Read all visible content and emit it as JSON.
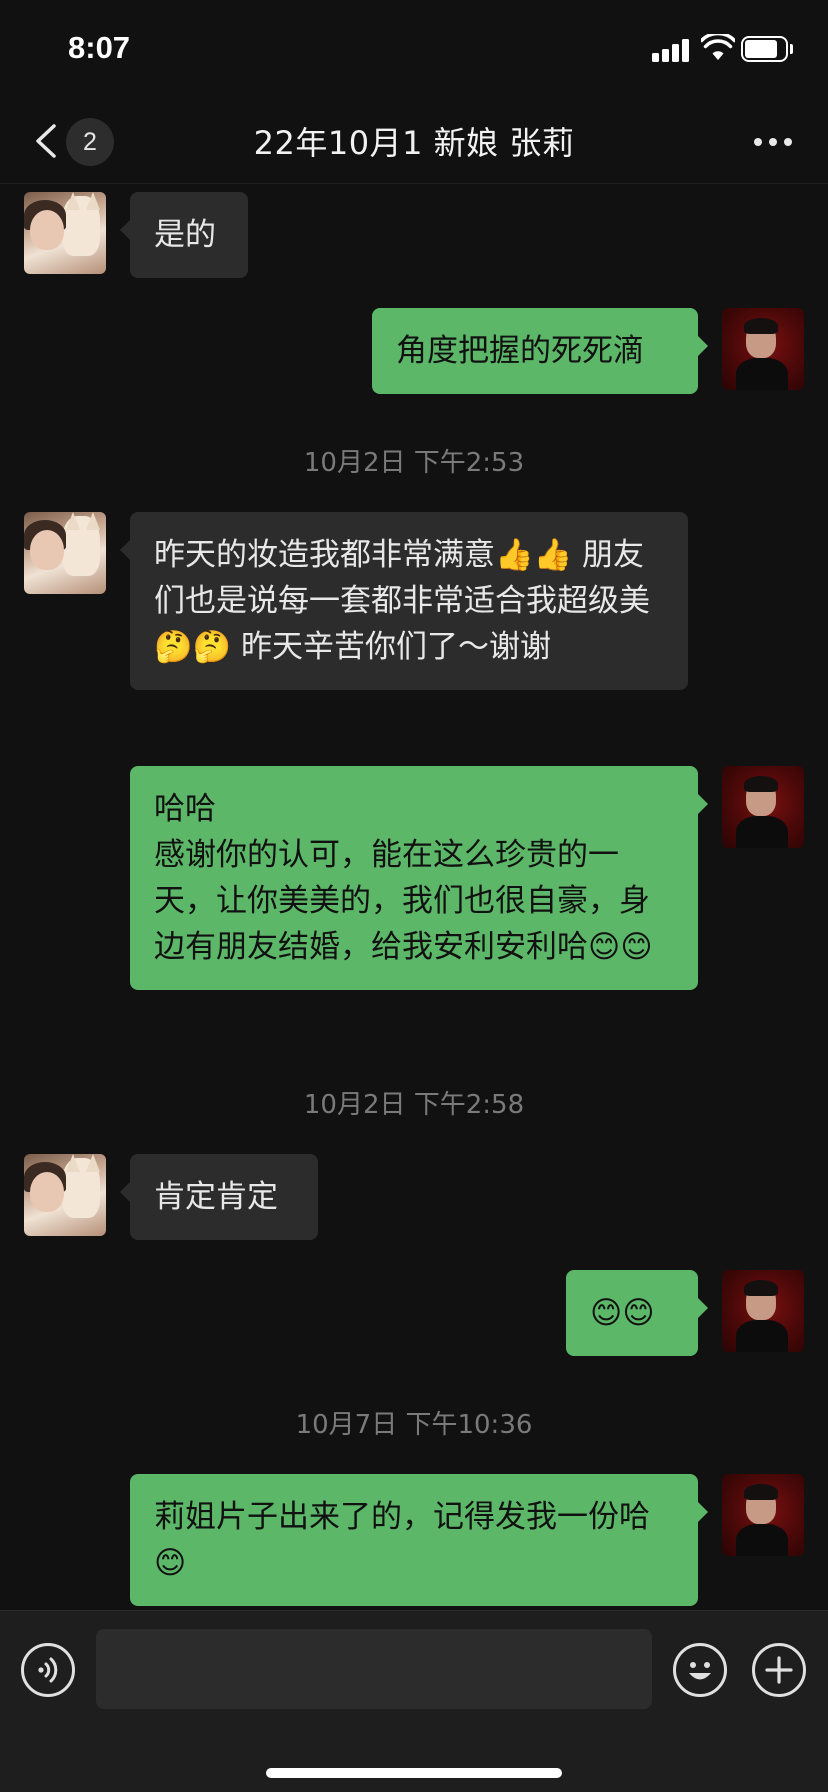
{
  "status_bar": {
    "time": "8:07"
  },
  "nav": {
    "unread_count": "2",
    "title": "22年10月1 新娘 张莉"
  },
  "messages": [
    {
      "kind": "in",
      "text": "是的"
    },
    {
      "kind": "out",
      "text": "角度把握的死死滴"
    },
    {
      "kind": "time",
      "text": "10月2日 下午2:53"
    },
    {
      "kind": "in",
      "text": "昨天的妆造我都非常满意👍👍 朋友们也是说每一套都非常适合我超级美🤔🤔 昨天辛苦你们了～谢谢"
    },
    {
      "kind": "out",
      "text": "哈哈\n感谢你的认可，能在这么珍贵的一天，让你美美的，我们也很自豪，身边有朋友结婚，给我安利安利哈😊😊"
    },
    {
      "kind": "time",
      "text": "10月2日 下午2:58"
    },
    {
      "kind": "in",
      "text": "肯定肯定"
    },
    {
      "kind": "out",
      "text": "😊😊"
    },
    {
      "kind": "time",
      "text": "10月7日 下午10:36"
    },
    {
      "kind": "out",
      "text": "莉姐片子出来了的，记得发我一份哈😊"
    }
  ],
  "input": {
    "placeholder": ""
  },
  "colors": {
    "incoming_bubble": "#2c2c2c",
    "outgoing_bubble": "#5cb868",
    "background": "#111111"
  }
}
